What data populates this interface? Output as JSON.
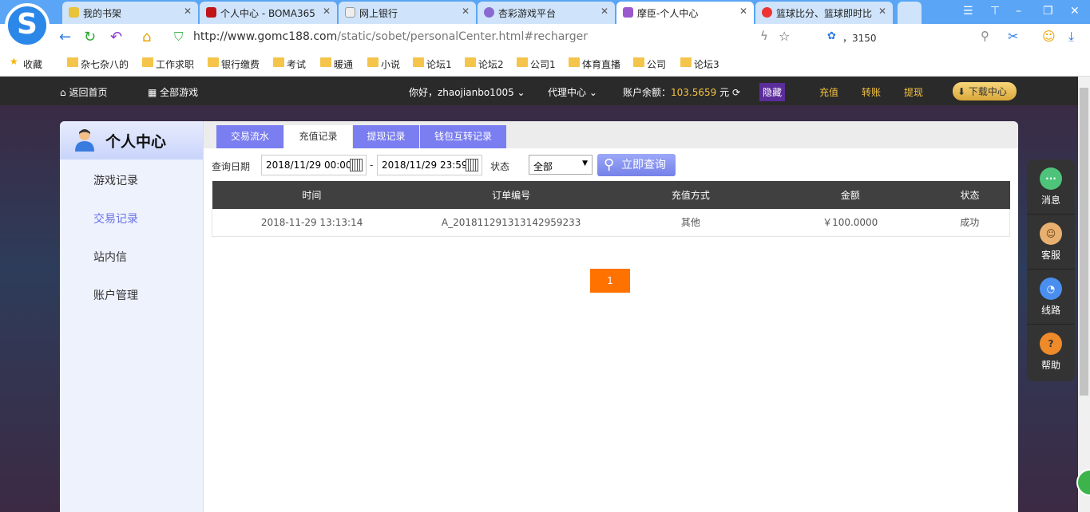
{
  "browser": {
    "tabs": [
      {
        "label": "我的书架",
        "color": "#e8c33b"
      },
      {
        "label": "个人中心 - BOMA365",
        "color": "#c0161a"
      },
      {
        "label": "网上银行",
        "color": "#ddd"
      },
      {
        "label": "杏彩游戏平台",
        "color": "#8a6ad0"
      },
      {
        "label": "摩臣-个人中心",
        "color": "#9b59d0",
        "active": true
      },
      {
        "label": "篮球比分、篮球即时比",
        "color": "#e33"
      }
    ],
    "url_host": "http://www.gomc188.com",
    "url_path": "/static/sobet/personalCenter.html#recharger",
    "search_value": "，3150",
    "bookmarks": [
      "收藏",
      "杂七杂八的",
      "工作求职",
      "银行缴费",
      "考试",
      "暖通",
      "小说",
      "论坛1",
      "论坛2",
      "公司1",
      "体育直播",
      "公司",
      "论坛3"
    ]
  },
  "topnav": {
    "home": "返回首页",
    "all_games": "全部游戏",
    "greeting": "你好，zhaojianbo1005",
    "agent": "代理中心",
    "balance_label": "账户余额：",
    "balance": "103.5659",
    "currency": "元",
    "hide": "隐藏",
    "recharge": "充值",
    "transfer": "转账",
    "withdraw": "提现",
    "download": "下载中心"
  },
  "sidebar": {
    "title": "个人中心",
    "items": [
      "游戏记录",
      "交易记录",
      "站内信",
      "账户管理"
    ]
  },
  "tabs": [
    "交易流水",
    "充值记录",
    "提现记录",
    "钱包互转记录"
  ],
  "filter": {
    "date_label": "查询日期",
    "start": "2018/11/29 00:00",
    "sep": "-",
    "end": "2018/11/29 23:59",
    "status_label": "状态",
    "status": "全部",
    "query": "立即查询"
  },
  "table": {
    "headers": [
      "时间",
      "订单编号",
      "充值方式",
      "金额",
      "状态"
    ],
    "rows": [
      [
        "2018-11-29 13:13:14",
        "A_201811291313142959233",
        "其他",
        "￥100.0000",
        "成功"
      ]
    ]
  },
  "pagination": {
    "current": "1"
  },
  "float": [
    "消息",
    "客服",
    "线路",
    "帮助"
  ]
}
